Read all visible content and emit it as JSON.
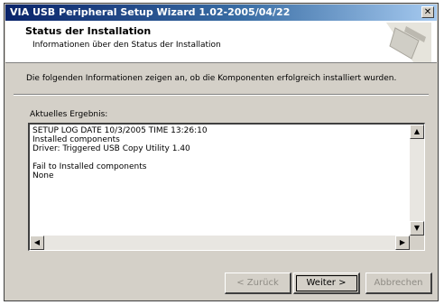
{
  "window": {
    "title": "VIA USB Peripheral Setup Wizard 1.02-2005/04/22"
  },
  "header": {
    "title": "Status der Installation",
    "subtitle": "Informationen über den Status der Installation"
  },
  "description": "Die folgenden Informationen zeigen an, ob die Komponenten erfolgreich installiert wurden.",
  "results": {
    "group_label": "Aktuelles Ergebnis:",
    "log_lines": [
      "SETUP LOG DATE 10/3/2005 TIME 13:26:10",
      "Installed components",
      "Driver: Triggered USB Copy Utility 1.40",
      "",
      "Fail to Installed components",
      "None"
    ]
  },
  "buttons": {
    "back_label": "< Zurück",
    "next_label": "Weiter >",
    "cancel_label": "Abbrechen"
  }
}
